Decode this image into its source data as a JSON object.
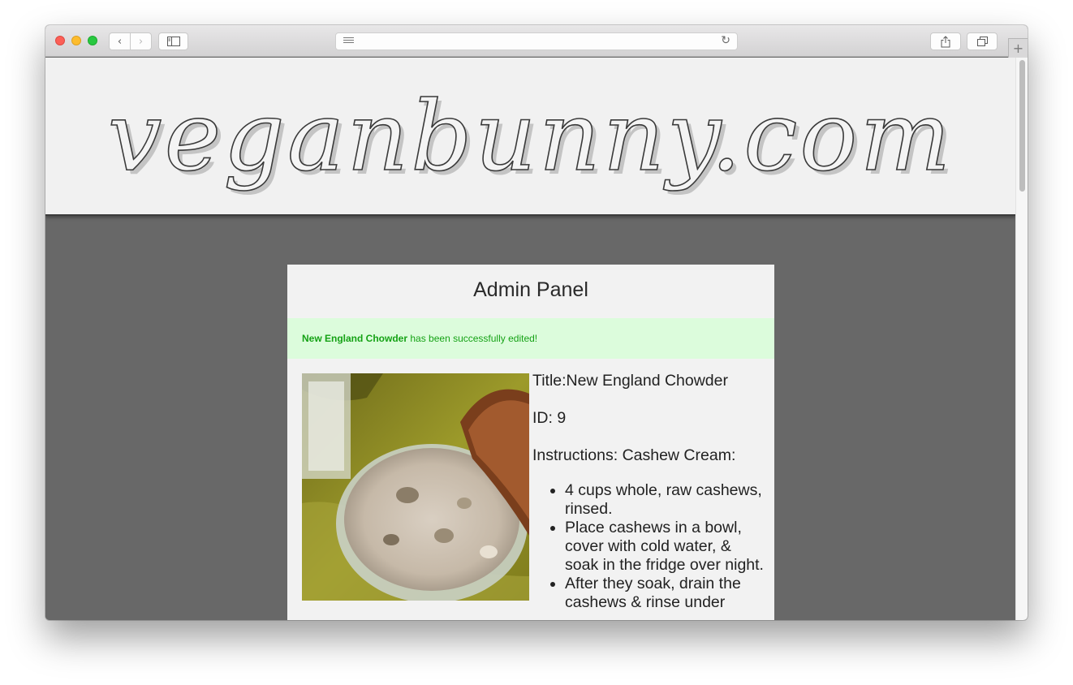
{
  "browser": {
    "back_icon": "‹",
    "forward_icon": "›",
    "reload_icon": "↻",
    "newtab_icon": "+"
  },
  "site": {
    "logo_text": "veganbunny.com"
  },
  "panel": {
    "title": "Admin Panel",
    "alert": {
      "item_name": "New England Chowder",
      "message": "has been successfully edited!"
    },
    "recipe": {
      "title_label": "Title:",
      "title_value": "New England Chowder",
      "id_label": "ID:",
      "id_value": "9",
      "instructions_label": "Instructions:",
      "instructions_heading": "Cashew Cream:",
      "steps": [
        "4 cups whole, raw cashews, rinsed.",
        "Place cashews in a bowl, cover with cold water, & soak in the fridge over night.",
        "After they soak, drain the cashews & rinse under"
      ]
    }
  },
  "colors": {
    "alert_bg": "#dcfcdc",
    "alert_text": "#15a215",
    "page_bg": "#686868",
    "panel_bg": "#f2f2f2"
  }
}
